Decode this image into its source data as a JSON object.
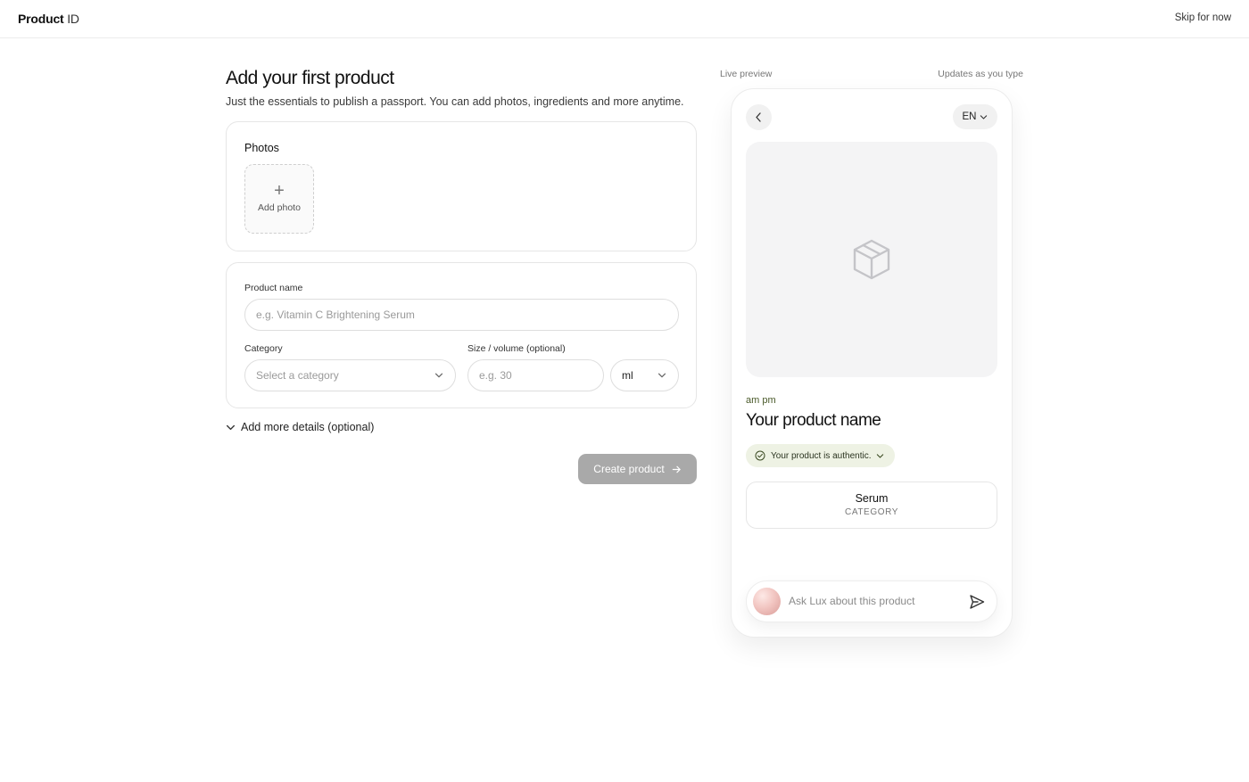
{
  "header": {
    "brand_strong": "Product",
    "brand_light": "ID",
    "skip_label": "Skip for now"
  },
  "form": {
    "title": "Add your first product",
    "subtitle": "Just the essentials to publish a passport. You can add photos, ingredients and more anytime.",
    "photos_label": "Photos",
    "add_photo_label": "Add photo",
    "product_name_label": "Product name",
    "product_name_placeholder": "e.g. Vitamin C Brightening Serum",
    "category_label": "Category",
    "category_placeholder": "Select a category",
    "size_label": "Size / volume (optional)",
    "size_placeholder": "e.g. 30",
    "unit_value": "ml",
    "more_details_label": "Add more details (optional)",
    "create_label": "Create product"
  },
  "preview": {
    "live_label": "Live preview",
    "updates_label": "Updates as you type",
    "lang": "EN",
    "brand_name": "am pm",
    "product_name": "Your product name",
    "auth_label": "Your product is authentic.",
    "category_value": "Serum",
    "category_caption": "CATEGORY",
    "ask_placeholder": "Ask Lux about this product"
  },
  "icons": {
    "back": "chevron-left-icon",
    "lang_dropdown": "chevron-down-icon",
    "hero": "package-icon",
    "auth": "check-circle-icon",
    "send": "send-icon",
    "create_arrow": "arrow-right-icon"
  },
  "colors": {
    "accent_olive": "#4a5a2a",
    "auth_pill_bg": "#eef2e4",
    "button_disabled": "#a9a9a9"
  }
}
